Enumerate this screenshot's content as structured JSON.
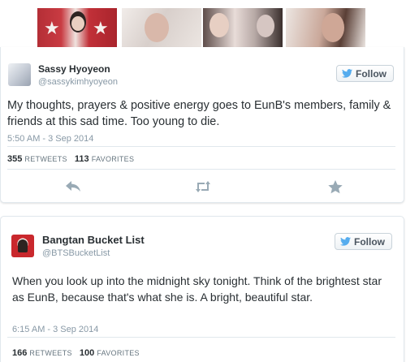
{
  "photo_strip": {
    "photos": [
      "photo-1",
      "photo-2",
      "photo-3",
      "photo-4"
    ]
  },
  "tweets": [
    {
      "name": "Sassy Hyoyeon",
      "handle": "@sassykimhyoyeon",
      "follow_label": "Follow",
      "text": "My thoughts, prayers & positive energy goes to EunB's members, family & friends at this sad time. Too young to die.",
      "timestamp": "5:50 AM - 3 Sep 2014",
      "retweets": "355",
      "retweets_label": "RETWEETS",
      "favorites": "113",
      "favorites_label": "FAVORITES",
      "actions": [
        "reply-icon",
        "retweet-icon",
        "favorite-icon"
      ]
    },
    {
      "name": "Bangtan Bucket List",
      "handle": "@BTSBucketList",
      "follow_label": "Follow",
      "text": "When you look up into the midnight sky tonight. Think of the brightest star as EunB, because that's what she is. A bright, beautiful star.",
      "timestamp": "6:15 AM - 3 Sep 2014",
      "retweets": "166",
      "retweets_label": "RETWEETS",
      "favorites": "100",
      "favorites_label": "FAVORITES"
    }
  ],
  "colors": {
    "twitter_blue": "#55acee",
    "text": "#292f33",
    "muted": "#8899a6",
    "border": "#e1e8ed"
  }
}
